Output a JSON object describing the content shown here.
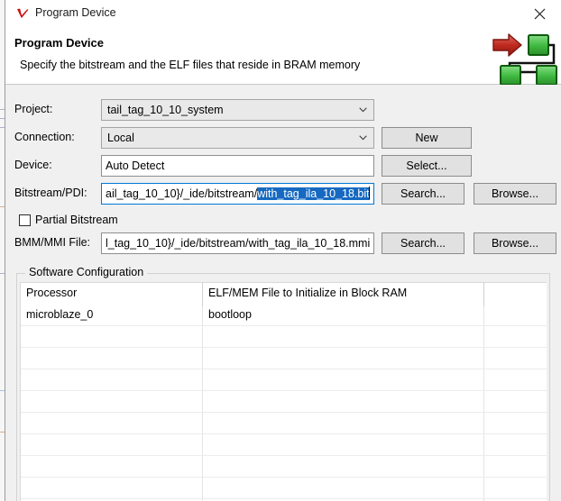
{
  "window": {
    "title": "Program Device",
    "app_icon": "vivado-logo-icon",
    "close_label": "✕"
  },
  "header": {
    "title": "Program Device",
    "subtitle": "Specify the bitstream and the ELF files that reside in BRAM memory",
    "graphic": "block-design-arrow-icon"
  },
  "form": {
    "project": {
      "label": "Project:",
      "value": "tail_tag_10_10_system"
    },
    "connection": {
      "label": "Connection:",
      "value": "Local",
      "button": "New"
    },
    "device": {
      "label": "Device:",
      "value": "Auto Detect",
      "button": "Select..."
    },
    "bitstream": {
      "label": "Bitstream/PDI:",
      "value_prefix": "ail_tag_10_10}/_ide/bitstream/",
      "value_selected": "with_tag_ila_10_18.bit",
      "search_button": "Search...",
      "browse_button": "Browse..."
    },
    "partial_bitstream": {
      "label": "Partial Bitstream",
      "checked": false
    },
    "bmm_mmi": {
      "label": "BMM/MMI File:",
      "value": "l_tag_10_10}/_ide/bitstream/with_tag_ila_10_18.mmi",
      "search_button": "Search...",
      "browse_button": "Browse..."
    }
  },
  "software_configuration": {
    "group_title": "Software Configuration",
    "columns": [
      "Processor",
      "ELF/MEM File to Initialize in Block RAM",
      ""
    ],
    "rows": [
      [
        "microblaze_0",
        "bootloop",
        ""
      ],
      [
        "",
        "",
        ""
      ],
      [
        "",
        "",
        ""
      ],
      [
        "",
        "",
        ""
      ],
      [
        "",
        "",
        ""
      ],
      [
        "",
        "",
        ""
      ],
      [
        "",
        "",
        ""
      ],
      [
        "",
        "",
        ""
      ],
      [
        "",
        "",
        ""
      ]
    ]
  },
  "colors": {
    "dialog_bg": "#f0f0f0",
    "selection_blue": "#1669c1",
    "focus_border": "#0078d7",
    "logo_red": "#c0392b",
    "logo_green": "#2f9e2f"
  }
}
